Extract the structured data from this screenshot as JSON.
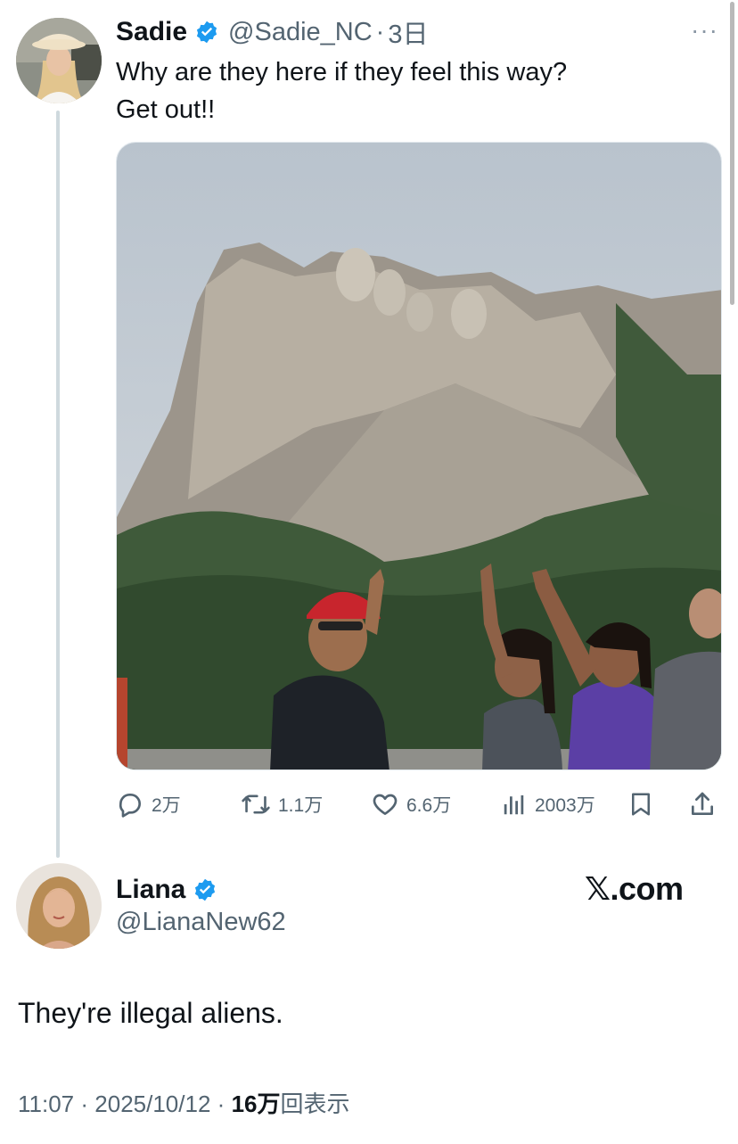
{
  "tweet": {
    "author_name": "Sadie",
    "author_handle": "@Sadie_NC",
    "separator": "·",
    "time": "3日",
    "more": "···",
    "text_lines": [
      "Why are they here if they feel this way?",
      "Get out!!"
    ],
    "verified": true
  },
  "actions": {
    "replies": "2万",
    "retweets": "1.1万",
    "likes": "6.6万",
    "views": "2003万"
  },
  "icons": {
    "verified": "verified-badge-icon",
    "reply": "reply-bubble-icon",
    "retweet": "retweet-icon",
    "like": "heart-icon",
    "views": "bar-chart-icon",
    "bookmark": "bookmark-icon",
    "share": "share-upload-icon"
  },
  "reply": {
    "author_name": "Liana",
    "author_handle": "@LianaNew62",
    "verified": true,
    "text": "They're illegal aliens.",
    "time": "11:07",
    "date": "2025/10/12",
    "separator": "·",
    "views_count": "16万",
    "views_label": "回表示"
  },
  "brand": {
    "watermark": "𝕏.com"
  },
  "colors": {
    "verified_blue": "#1d9bf0",
    "text_primary": "#0f1419",
    "text_secondary": "#536471",
    "thread_line": "#cfd9de"
  }
}
